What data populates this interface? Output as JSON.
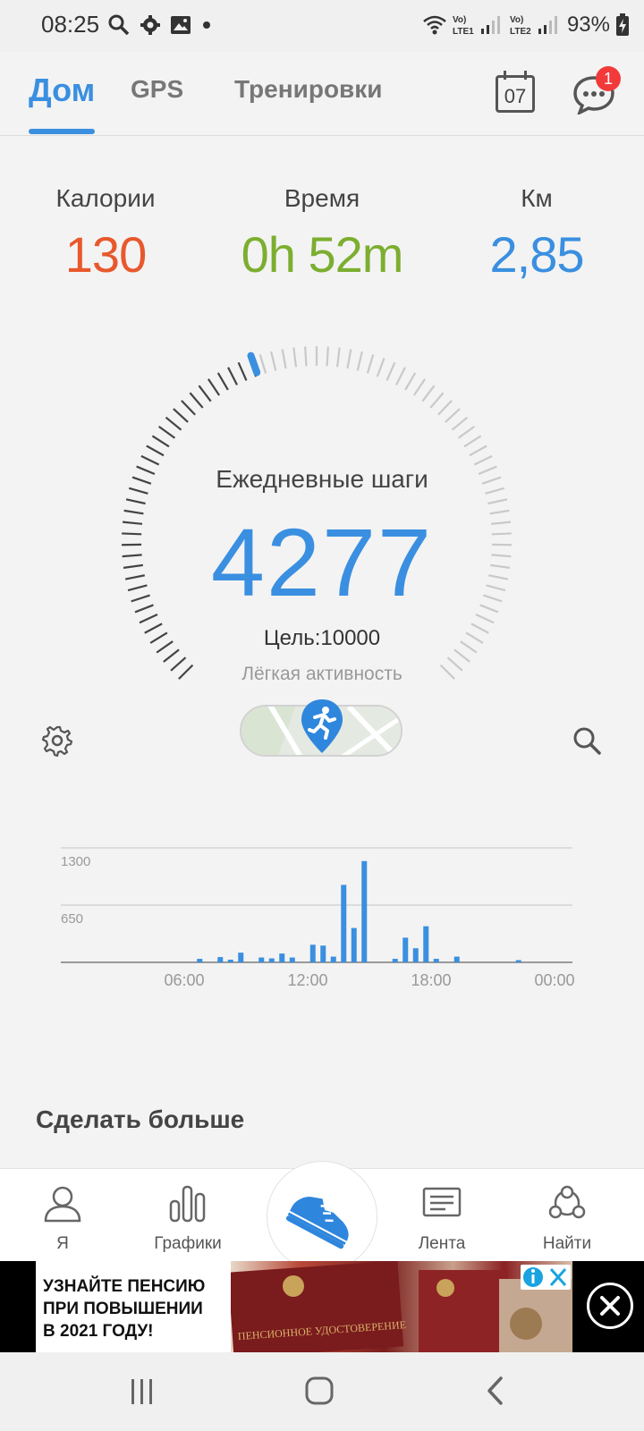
{
  "status_bar": {
    "time": "08:25",
    "battery": "93%",
    "sim1": "Vo) LTE1",
    "sim2": "Vo) LTE2"
  },
  "tabs": [
    {
      "label": "Дом",
      "active": true
    },
    {
      "label": "GPS",
      "active": false
    },
    {
      "label": "Тренировки",
      "active": false
    }
  ],
  "calendar_day": "07",
  "messages_badge": "1",
  "stats": {
    "calories": {
      "label": "Калории",
      "value": "130",
      "color": "#e8582c"
    },
    "time": {
      "label": "Время",
      "value": "0h 52m",
      "color": "#7cae2f"
    },
    "km": {
      "label": "Км",
      "value": "2,85",
      "color": "#3a8fe0"
    }
  },
  "gauge": {
    "title": "Ежедневные шаги",
    "steps": "4277",
    "goal_text": "Цель:10000",
    "level": "Лёгкая активность",
    "progress": 0.4277
  },
  "chart_data": {
    "type": "bar",
    "ylim": [
      0,
      1300
    ],
    "y_ticks": [
      "1300",
      "650"
    ],
    "x_ticks": [
      "06:00",
      "12:00",
      "18:00",
      "00:00"
    ],
    "x_range_hours": [
      0,
      24
    ],
    "bars": [
      {
        "hour": 6.75,
        "value": 40
      },
      {
        "hour": 7.75,
        "value": 60
      },
      {
        "hour": 8.25,
        "value": 30
      },
      {
        "hour": 8.75,
        "value": 110
      },
      {
        "hour": 9.75,
        "value": 55
      },
      {
        "hour": 10.25,
        "value": 45
      },
      {
        "hour": 10.75,
        "value": 100
      },
      {
        "hour": 11.25,
        "value": 55
      },
      {
        "hour": 12.25,
        "value": 200
      },
      {
        "hour": 12.75,
        "value": 190
      },
      {
        "hour": 13.25,
        "value": 65
      },
      {
        "hour": 13.75,
        "value": 880
      },
      {
        "hour": 14.25,
        "value": 390
      },
      {
        "hour": 14.75,
        "value": 1150
      },
      {
        "hour": 16.25,
        "value": 40
      },
      {
        "hour": 16.75,
        "value": 280
      },
      {
        "hour": 17.25,
        "value": 160
      },
      {
        "hour": 17.75,
        "value": 410
      },
      {
        "hour": 18.25,
        "value": 40
      },
      {
        "hour": 19.25,
        "value": 65
      },
      {
        "hour": 22.25,
        "value": 25
      }
    ],
    "bar_color": "#3a8fe0",
    "grid": true
  },
  "section_title": "Сделать больше",
  "bottom_nav": [
    {
      "label": "Я",
      "icon": "profile-icon"
    },
    {
      "label": "Графики",
      "icon": "bar-chart-icon"
    },
    {
      "label": "",
      "icon": "sneaker-icon"
    },
    {
      "label": "Лента",
      "icon": "feed-icon"
    },
    {
      "label": "Найти",
      "icon": "community-icon"
    }
  ],
  "ad": {
    "text_line1": "УЗНАЙТЕ ПЕНСИЮ",
    "text_line2": "ПРИ ПОВЫШЕНИИ",
    "text_line3": "В 2021 ГОДУ!",
    "book_text": "ПЕНСИОННОЕ УДОСТОВЕРЕНИЕ"
  }
}
